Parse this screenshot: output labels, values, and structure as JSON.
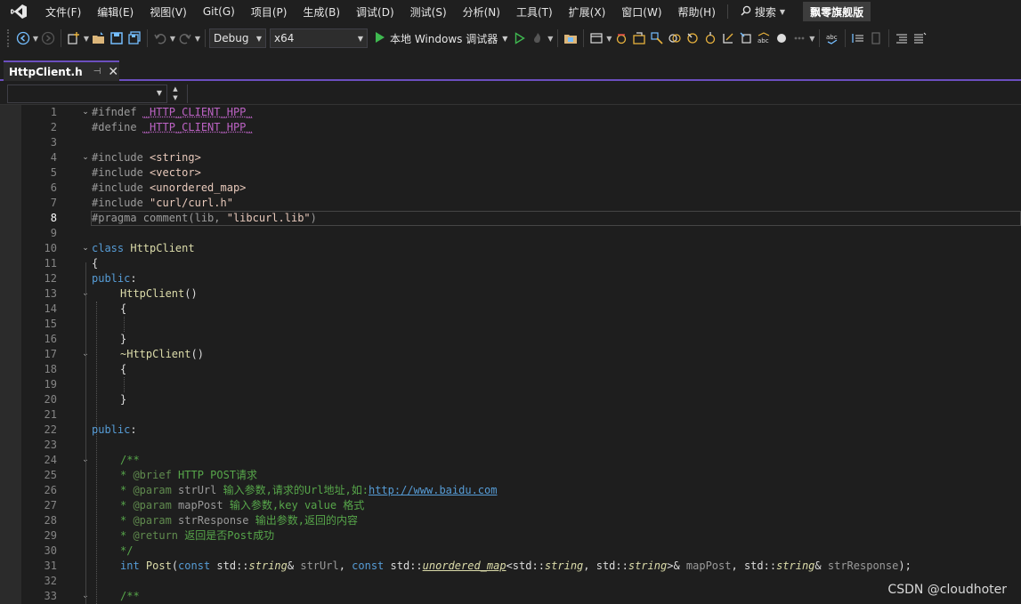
{
  "menubar": {
    "items": [
      "文件(F)",
      "编辑(E)",
      "视图(V)",
      "Git(G)",
      "项目(P)",
      "生成(B)",
      "调试(D)",
      "测试(S)",
      "分析(N)",
      "工具(T)",
      "扩展(X)",
      "窗口(W)",
      "帮助(H)"
    ],
    "search_label": "搜索",
    "solution_name": "飘零旗舰版"
  },
  "toolbar": {
    "config": "Debug",
    "platform": "x64",
    "run_label": "本地 Windows 调试器"
  },
  "tab": {
    "filename": "HttpClient.h"
  },
  "colors": {
    "accent": "#6c4fbf",
    "keyword": "#569cd6",
    "class": "#4ec9b0",
    "function": "#dcdcaa",
    "comment": "#57a64a",
    "string": "#e8c9bb",
    "macro": "#bd63c5"
  },
  "editor": {
    "active_line": 8,
    "lines": [
      {
        "n": "1",
        "fold": "open"
      },
      {
        "n": "2"
      },
      {
        "n": "3"
      },
      {
        "n": "4",
        "fold": "open"
      },
      {
        "n": "5"
      },
      {
        "n": "6"
      },
      {
        "n": "7"
      },
      {
        "n": "8"
      },
      {
        "n": "9"
      },
      {
        "n": "10",
        "fold": "open"
      },
      {
        "n": "11"
      },
      {
        "n": "12"
      },
      {
        "n": "13",
        "fold": "open"
      },
      {
        "n": "14"
      },
      {
        "n": "15"
      },
      {
        "n": "16"
      },
      {
        "n": "17",
        "fold": "open"
      },
      {
        "n": "18"
      },
      {
        "n": "19"
      },
      {
        "n": "20"
      },
      {
        "n": "21"
      },
      {
        "n": "22"
      },
      {
        "n": "23"
      },
      {
        "n": "24",
        "fold": "open"
      },
      {
        "n": "25"
      },
      {
        "n": "26"
      },
      {
        "n": "27"
      },
      {
        "n": "28"
      },
      {
        "n": "29"
      },
      {
        "n": "30"
      },
      {
        "n": "31"
      },
      {
        "n": "32"
      },
      {
        "n": "33",
        "fold": "open"
      }
    ],
    "code": {
      "l1a": "#ifndef ",
      "l1b": "_HTTP_CLIENT_HPP_",
      "l2a": "#define ",
      "l2b": "_HTTP_CLIENT_HPP_",
      "l4a": "#include ",
      "l4b": "<string>",
      "l5a": "#include ",
      "l5b": "<vector>",
      "l6a": "#include ",
      "l6b": "<unordered_map>",
      "l7a": "#include ",
      "l7b": "\"curl/curl.h\"",
      "l8a": "#pragma comment(lib, ",
      "l8b": "\"libcurl.lib\"",
      "l8c": ")",
      "l10a": "class ",
      "l10b": "HttpClient",
      "l11": "{",
      "l12a": "public",
      "l12b": ":",
      "l13a": "HttpClient",
      "l13b": "()",
      "l14": "{",
      "l16": "}",
      "l17a": "~HttpClient",
      "l17b": "()",
      "l18": "{",
      "l20": "}",
      "l22a": "public",
      "l22b": ":",
      "l24": "/**",
      "l25a": "* ",
      "l25b": "@brief",
      "l25c": " HTTP POST请求",
      "l26a": "* ",
      "l26b": "@param",
      "l26c": " strUrl",
      "l26d": " 输入参数,请求的Url地址,如:",
      "l26e": "http://www.baidu.com",
      "l27a": "* ",
      "l27b": "@param",
      "l27c": " mapPost",
      "l27d": " 输入参数,key value 格式",
      "l28a": "* ",
      "l28b": "@param",
      "l28c": " strResponse",
      "l28d": " 输出参数,返回的内容",
      "l29a": "* ",
      "l29b": "@return",
      "l29c": " 返回是否Post成功",
      "l30": "*/",
      "l31a": "int ",
      "l31b": "Post",
      "l31c": "(",
      "l31d": "const ",
      "l31e": "std::",
      "l31f": "string",
      "l31g": "& ",
      "l31h": "strUrl",
      "l31i": ", ",
      "l31j": "const ",
      "l31k": "std::",
      "l31l": "unordered_map",
      "l31m": "<",
      "l31n": "std::",
      "l31o": "string",
      "l31p": ", ",
      "l31q": "std::",
      "l31r": "string",
      "l31s": ">& ",
      "l31t": "mapPost",
      "l31u": ", ",
      "l31v": "std::",
      "l31w": "string",
      "l31x": "& ",
      "l31y": "strResponse",
      "l31z": ");",
      "l33": "/**"
    }
  },
  "watermark": "CSDN @cloudhoter"
}
